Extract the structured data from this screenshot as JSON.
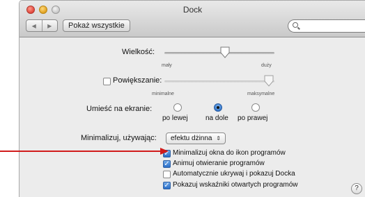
{
  "window": {
    "title": "Dock"
  },
  "toolbar": {
    "back_label": "◀",
    "forward_label": "▶",
    "show_all_label": "Pokaż wszystkie",
    "search_placeholder": "",
    "search_value": ""
  },
  "size": {
    "label": "Wielkość:",
    "min_label": "mały",
    "max_label": "duży",
    "value_fraction": 0.55
  },
  "magnification": {
    "label": "Powiększanie:",
    "checked": false,
    "min_label": "minimalne",
    "max_label": "maksymalne",
    "value_fraction": 0.95
  },
  "position": {
    "label": "Umieść na ekranie:",
    "options": [
      {
        "label": "po lewej",
        "selected": false
      },
      {
        "label": "na dole",
        "selected": true
      },
      {
        "label": "po prawej",
        "selected": false
      }
    ]
  },
  "minimize": {
    "label": "Minimalizuj, używając:",
    "selected": "efektu dżinna",
    "arrows": "⇕"
  },
  "checkboxes": [
    {
      "label": "Minimalizuj okna do ikon programów",
      "checked": true
    },
    {
      "label": "Animuj otwieranie programów",
      "checked": true
    },
    {
      "label": "Automatycznie ukrywaj i pokazuj Docka",
      "checked": false
    },
    {
      "label": "Pokazuj wskaźniki otwartych programów",
      "checked": true
    }
  ],
  "help": {
    "label": "?"
  },
  "check_glyph": "✓",
  "colors": {
    "accent": "#2a6fc9",
    "arrow": "#d11a1a"
  }
}
